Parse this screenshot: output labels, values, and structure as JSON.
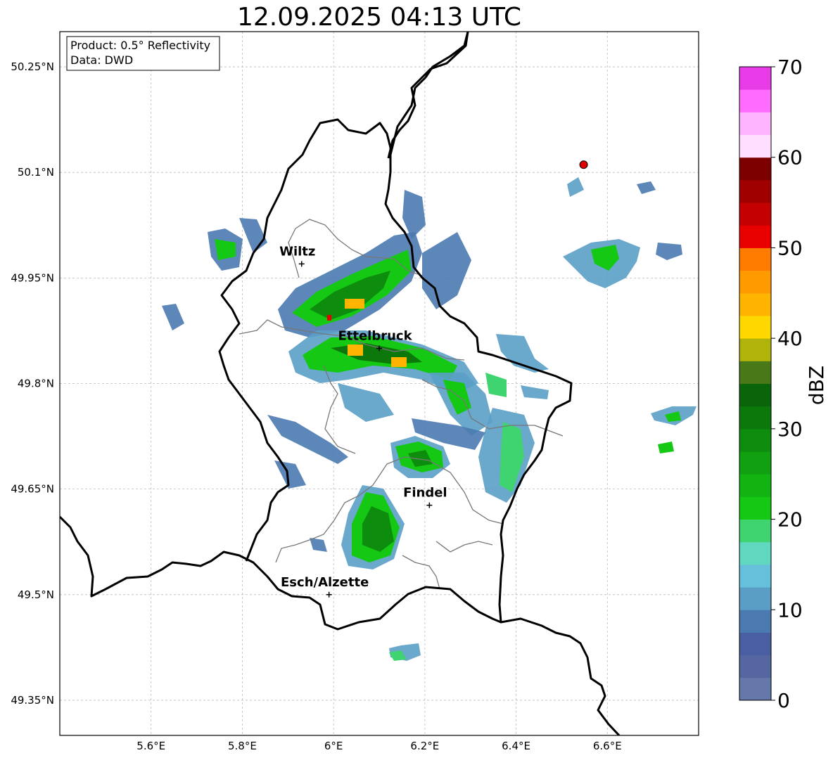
{
  "title": "12.09.2025 04:13 UTC",
  "info_box": {
    "product": "Product: 0.5° Reflectivity",
    "source": "Data: DWD"
  },
  "map": {
    "lon_range": [
      5.4,
      6.8
    ],
    "lat_range": [
      49.3,
      50.3
    ],
    "lon_ticks": [
      {
        "value": 5.6,
        "label": "5.6°E"
      },
      {
        "value": 5.8,
        "label": "5.8°E"
      },
      {
        "value": 6.0,
        "label": "6°E"
      },
      {
        "value": 6.2,
        "label": "6.2°E"
      },
      {
        "value": 6.4,
        "label": "6.4°E"
      },
      {
        "value": 6.6,
        "label": "6.6°E"
      }
    ],
    "lat_ticks": [
      {
        "value": 50.25,
        "label": "50.25°N"
      },
      {
        "value": 50.1,
        "label": "50.1°N"
      },
      {
        "value": 49.95,
        "label": "49.95°N"
      },
      {
        "value": 49.8,
        "label": "49.8°N"
      },
      {
        "value": 49.65,
        "label": "49.65°N"
      },
      {
        "value": 49.5,
        "label": "49.5°N"
      },
      {
        "value": 49.35,
        "label": "49.35°N"
      }
    ],
    "gridlines": true,
    "cities": [
      {
        "name": "Wiltz",
        "lon": 5.93,
        "lat": 49.97
      },
      {
        "name": "Ettelbruck",
        "lon": 6.1,
        "lat": 49.85
      },
      {
        "name": "Findel",
        "lon": 6.21,
        "lat": 49.627
      },
      {
        "name": "Esch/Alzette",
        "lon": 5.99,
        "lat": 49.5
      }
    ],
    "radar_site": {
      "lon": 6.548,
      "lat": 50.111,
      "color": "#e00000"
    }
  },
  "colorbar": {
    "label": "dBZ",
    "min": 0,
    "max": 70,
    "step": 2.5,
    "ticks": [
      {
        "value": 0,
        "label": "0"
      },
      {
        "value": 10,
        "label": "10"
      },
      {
        "value": 20,
        "label": "20"
      },
      {
        "value": 30,
        "label": "30"
      },
      {
        "value": 40,
        "label": "40"
      },
      {
        "value": 50,
        "label": "50"
      },
      {
        "value": 60,
        "label": "60"
      },
      {
        "value": 70,
        "label": "70"
      }
    ],
    "colors": [
      "#6677aa",
      "#5566a0",
      "#4a5fa2",
      "#4a7ab0",
      "#5a9ec6",
      "#66c0dc",
      "#60d8c0",
      "#40d470",
      "#14c814",
      "#12b412",
      "#10a010",
      "#0e8c0e",
      "#0c780c",
      "#0a640a",
      "#487818",
      "#b0b40a",
      "#ffd800",
      "#ffb400",
      "#ff9a00",
      "#ff7c00",
      "#e80000",
      "#c40000",
      "#a00000",
      "#7c0000",
      "#ffdeff",
      "#ffb4ff",
      "#ff6cff",
      "#e83ce8"
    ]
  }
}
